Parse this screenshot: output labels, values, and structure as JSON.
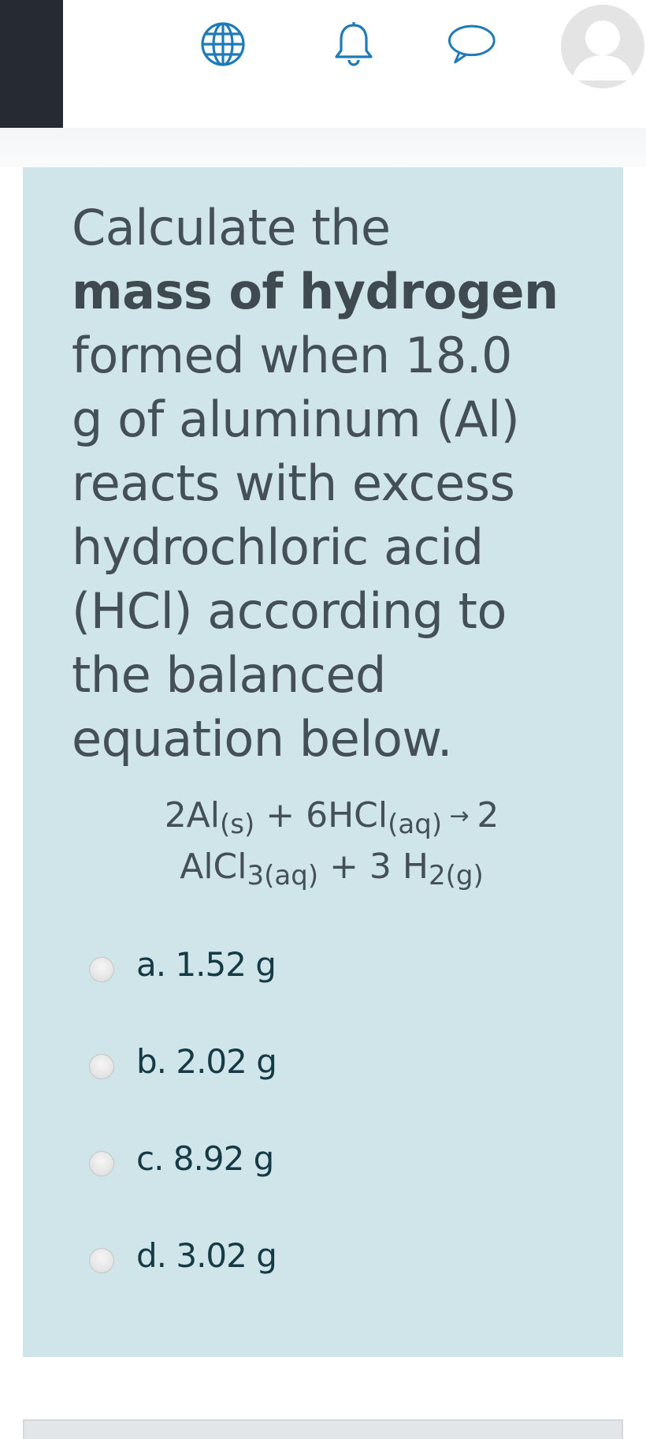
{
  "navbar": {
    "icons": [
      "globe-icon",
      "bell-icon",
      "chat-icon",
      "user-avatar"
    ],
    "accent_color": "#1f7ab8",
    "drawer_color": "#262a33"
  },
  "question": {
    "lines": [
      {
        "pre": "Calculate the",
        "bold": ""
      },
      {
        "pre": "",
        "bold": "mass of hydrogen"
      },
      {
        "pre": "formed when 18.0",
        "bold": ""
      },
      {
        "pre": "g of aluminum (Al)",
        "bold": ""
      },
      {
        "pre": "reacts with excess",
        "bold": ""
      },
      {
        "pre": "hydrochloric acid",
        "bold": ""
      },
      {
        "pre": "(HCl) according to",
        "bold": ""
      },
      {
        "pre": "the balanced",
        "bold": ""
      },
      {
        "pre": "equation below.",
        "bold": ""
      }
    ],
    "equation": {
      "line1": {
        "a": "2Al",
        "a_sub": "(s)",
        "b": " + 6HCl",
        "b_sub": "(aq)",
        "arrow": " → ",
        "c": "2"
      },
      "line2": {
        "a": "AlCl",
        "a_sub": "3(aq)",
        "b": " + 3 H",
        "b_sub": "2(g)"
      }
    },
    "panel_color": "#cfe5ea"
  },
  "answers": [
    {
      "label": "a. 1.52 g",
      "selected": false
    },
    {
      "label": "b. 2.02 g",
      "selected": false
    },
    {
      "label": "c. 8.92 g",
      "selected": false
    },
    {
      "label": "d. 3.02 g",
      "selected": false
    }
  ]
}
